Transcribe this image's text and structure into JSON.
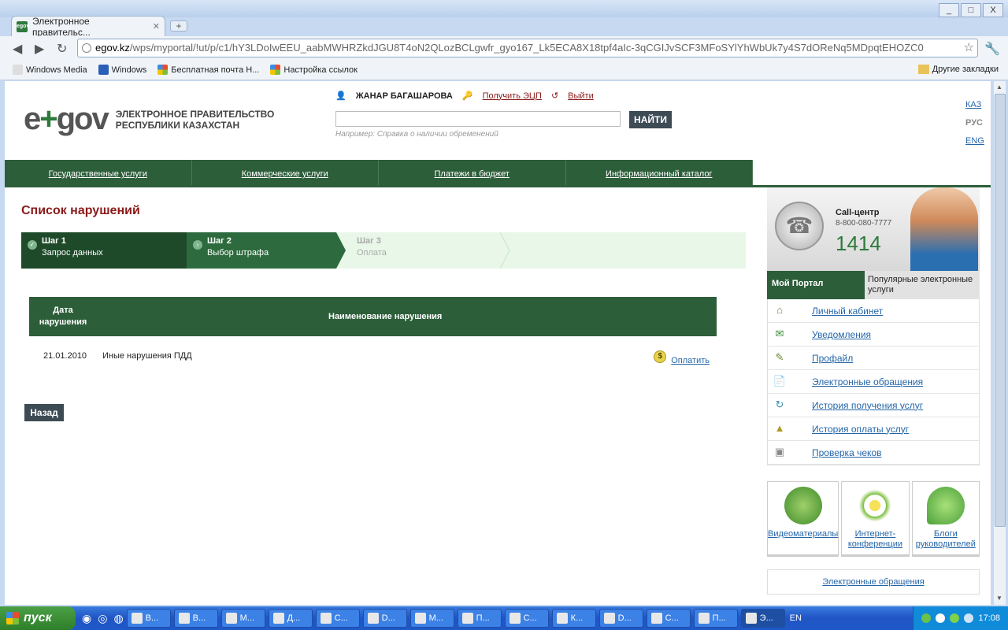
{
  "browser": {
    "tab_title": "Электронное правительс...",
    "url_domain": "egov.kz",
    "url_path": "/wps/myportal/!ut/p/c1/hY3LDoIwEEU_aabMWHRZkdJGU8T4oN2QLozBCLgwfr_gyo167_Lk5ECA8X18tpf4aIc-3qCGIJvSCF3MFoSYlYhWbUk7y4S7dOReNq5MDpqtEHOZC0",
    "window_buttons": [
      "_",
      "□",
      "X"
    ],
    "bookmarks": [
      "Windows Media",
      "Windows",
      "Бесплатная почта Н...",
      "Настройка ссылок"
    ],
    "other_bookmarks": "Другие закладки"
  },
  "header": {
    "logo_text": "e✜gov",
    "logo_line1": "ЭЛЕКТРОННОЕ ПРАВИТЕЛЬСТВО",
    "logo_line2": "РЕСПУБЛИКИ КАЗАХСТАН",
    "user_name": "ЖАНАР БАГАШАРОВА",
    "get_eds": "Получить ЭЦП",
    "logout": "Выйти",
    "search_value": "",
    "find_button": "НАЙТИ",
    "search_hint": "Например: Справка о наличии обременений",
    "langs": [
      "КАЗ",
      "РУС",
      "ENG"
    ]
  },
  "nav": [
    "Государственные услуги",
    "Коммерческие услуги",
    "Платежи в бюджет",
    "Информационный каталог"
  ],
  "main": {
    "title": "Список нарушений",
    "steps": [
      {
        "title": "Шаг 1",
        "sub": "Запрос данных"
      },
      {
        "title": "Шаг 2",
        "sub": "Выбор штрафа"
      },
      {
        "title": "Шаг 3",
        "sub": "Оплата"
      }
    ],
    "table": {
      "col_date_1": "Дата",
      "col_date_2": "нарушения",
      "col_name": "Наименование нарушения",
      "rows": [
        {
          "date": "21.01.2010",
          "name": "Иные нарушения ПДД",
          "action": "Оплатить"
        }
      ]
    },
    "back_button": "Назад"
  },
  "sidebar": {
    "call_center": "Call-центр",
    "phone": "8-800-080-7777",
    "short_number": "1414",
    "tab_portal": "Мой Портал",
    "tab_popular": "Популярные электронные услуги",
    "items": [
      "Личный кабинет",
      "Уведомления",
      "Профайл",
      "Электронные обращения",
      "История получения услуг",
      "История оплаты услуг",
      "Проверка чеков"
    ],
    "tiles": [
      "Видеоматериалы",
      "Интернет-конференции",
      "Блоги руководителей"
    ],
    "footer_link": "Электронные обращения"
  },
  "taskbar": {
    "start": "пуск",
    "buttons": [
      "В...",
      "В...",
      "М...",
      "Д...",
      "С...",
      "D...",
      "М...",
      "П...",
      "С...",
      "К...",
      "D...",
      "С...",
      "П...",
      "Э..."
    ],
    "language": "EN",
    "clock": "17:08"
  }
}
